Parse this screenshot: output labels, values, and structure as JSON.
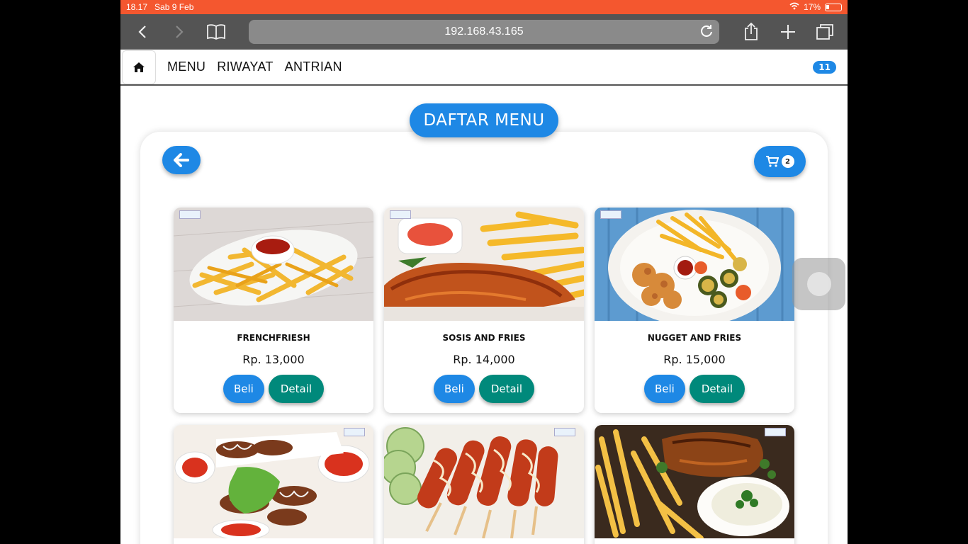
{
  "status": {
    "time": "18.17",
    "date": "Sab 9 Feb",
    "battery": "17%"
  },
  "browser": {
    "url": "192.168.43.165"
  },
  "nav": {
    "links": [
      "MENU",
      "RIWAYAT",
      "ANTRIAN"
    ],
    "badge": "11"
  },
  "page": {
    "title": "DAFTAR MENU",
    "cart_count": "2"
  },
  "buttons": {
    "buy": "Beli",
    "detail": "Detail"
  },
  "menu_items": [
    {
      "name": "FRENCHFRIESH",
      "price": "Rp. 13,000"
    },
    {
      "name": "SOSIS AND FRIES",
      "price": "Rp. 14,000"
    },
    {
      "name": "NUGGET AND FRIES",
      "price": "Rp. 15,000"
    },
    {
      "name": "",
      "price": ""
    },
    {
      "name": "",
      "price": ""
    },
    {
      "name": "",
      "price": ""
    }
  ],
  "colors": {
    "primary": "#1e88e5",
    "detail": "#00897b",
    "statusbar": "#f4572f"
  }
}
